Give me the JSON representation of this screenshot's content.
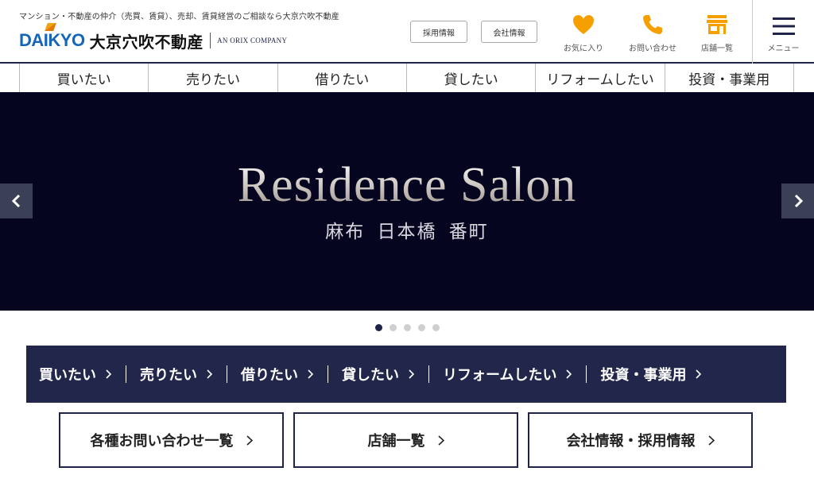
{
  "header": {
    "tagline": "マンション・不動産の仲介（売買、賃貸）、売却、賃貸経営のご相談なら大京穴吹不動産",
    "logo_latin": "DAIKYO",
    "logo_ja": "大京穴吹不動産",
    "logo_orix": "AN ORIX COMPANY",
    "recruit_label": "採用情報",
    "company_label": "会社情報",
    "favorites_label": "お気に入り",
    "contact_label": "お問い合わせ",
    "stores_label": "店舗一覧",
    "menu_label": "メニュー",
    "icon_color": "#f5a000",
    "icons": {
      "favorites": "heart-icon",
      "contact": "phone-icon",
      "stores": "store-icon",
      "menu": "hamburger-icon"
    }
  },
  "top_nav": [
    {
      "label": "買いたい"
    },
    {
      "label": "売りたい"
    },
    {
      "label": "借りたい"
    },
    {
      "label": "貸したい"
    },
    {
      "label": "リフォームしたい"
    },
    {
      "label": "投資・事業用"
    }
  ],
  "hero": {
    "title": "Residence Salon",
    "subtitle": "麻布 日本橋 番町",
    "background_color": "#050520",
    "slide_count": 5,
    "active_slide": 1
  },
  "category_bar": {
    "background_color": "#22264a",
    "items": [
      {
        "label": "買いたい"
      },
      {
        "label": "売りたい"
      },
      {
        "label": "借りたい"
      },
      {
        "label": "貸したい"
      },
      {
        "label": "リフォームしたい"
      },
      {
        "label": "投資・事業用"
      }
    ]
  },
  "bottom_buttons": {
    "contact_list": "各種お問い合わせ一覧",
    "stores": "店舗一覧",
    "company_recruit": "会社情報・採用情報"
  },
  "colors": {
    "navy": "#1f2347",
    "brand_blue": "#1566b8",
    "brand_orange": "#f0a30a"
  }
}
